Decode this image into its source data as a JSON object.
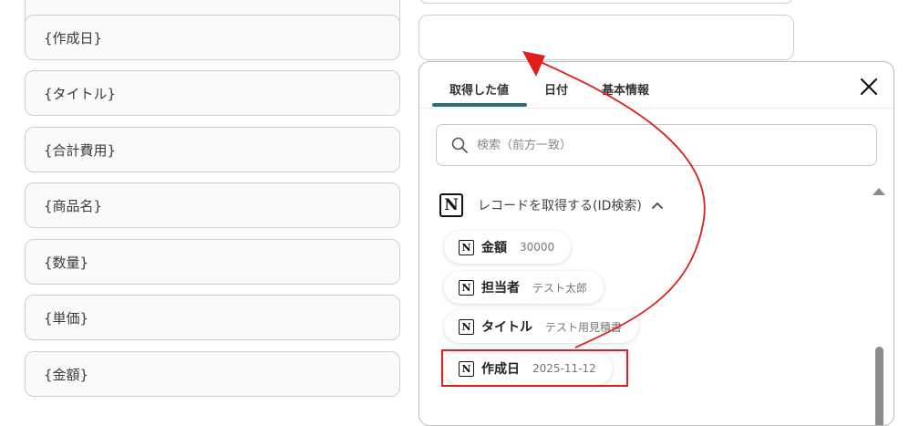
{
  "left_fields": [
    {
      "label": "{作成日}"
    },
    {
      "label": "{タイトル}"
    },
    {
      "label": "{合計費用}"
    },
    {
      "label": "{商品名}"
    },
    {
      "label": "{数量}"
    },
    {
      "label": "{単価}"
    },
    {
      "label": "{金額}"
    }
  ],
  "panel": {
    "tabs": [
      {
        "label": "取得した値",
        "active": true
      },
      {
        "label": "日付",
        "active": false
      },
      {
        "label": "基本情報",
        "active": false
      }
    ],
    "close_icon": "close-icon",
    "search": {
      "placeholder": "検索（前方一致）",
      "value": "",
      "icon": "search-icon"
    },
    "section": {
      "label": "レコードを取得する(ID検索)",
      "icon": "notion-icon",
      "expanded": true
    },
    "items": [
      {
        "name": "金額",
        "value": "30000"
      },
      {
        "name": "担当者",
        "value": "テスト太郎"
      },
      {
        "name": "タイトル",
        "value": "テスト用見積書"
      },
      {
        "name": "作成日",
        "value": "2025-11-12",
        "highlighted": true
      }
    ]
  },
  "colors": {
    "tab_active": "#2a6e78",
    "highlight": "#e01e1e",
    "arrow": "#e01e1e"
  }
}
